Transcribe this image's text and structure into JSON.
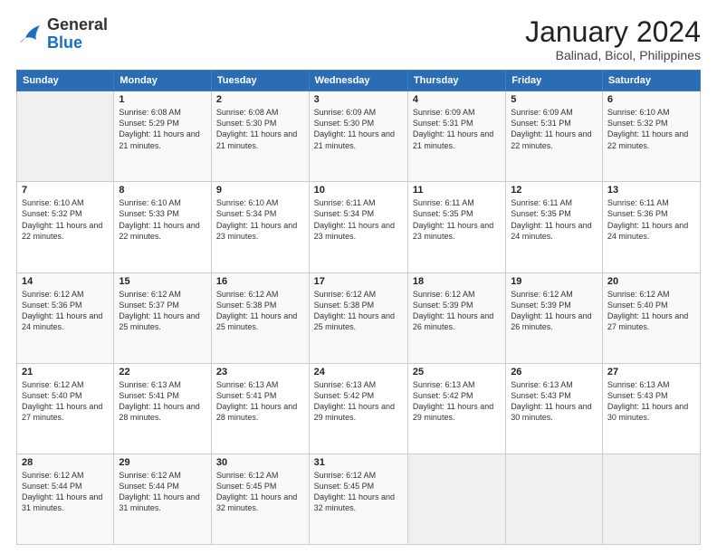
{
  "header": {
    "logo": {
      "general": "General",
      "blue": "Blue"
    },
    "title": "January 2024",
    "subtitle": "Balinad, Bicol, Philippines"
  },
  "days_header": [
    "Sunday",
    "Monday",
    "Tuesday",
    "Wednesday",
    "Thursday",
    "Friday",
    "Saturday"
  ],
  "weeks": [
    [
      {
        "day": "",
        "sunrise": "",
        "sunset": "",
        "daylight": ""
      },
      {
        "day": "1",
        "sunrise": "Sunrise: 6:08 AM",
        "sunset": "Sunset: 5:29 PM",
        "daylight": "Daylight: 11 hours and 21 minutes."
      },
      {
        "day": "2",
        "sunrise": "Sunrise: 6:08 AM",
        "sunset": "Sunset: 5:30 PM",
        "daylight": "Daylight: 11 hours and 21 minutes."
      },
      {
        "day": "3",
        "sunrise": "Sunrise: 6:09 AM",
        "sunset": "Sunset: 5:30 PM",
        "daylight": "Daylight: 11 hours and 21 minutes."
      },
      {
        "day": "4",
        "sunrise": "Sunrise: 6:09 AM",
        "sunset": "Sunset: 5:31 PM",
        "daylight": "Daylight: 11 hours and 21 minutes."
      },
      {
        "day": "5",
        "sunrise": "Sunrise: 6:09 AM",
        "sunset": "Sunset: 5:31 PM",
        "daylight": "Daylight: 11 hours and 22 minutes."
      },
      {
        "day": "6",
        "sunrise": "Sunrise: 6:10 AM",
        "sunset": "Sunset: 5:32 PM",
        "daylight": "Daylight: 11 hours and 22 minutes."
      }
    ],
    [
      {
        "day": "7",
        "sunrise": "Sunrise: 6:10 AM",
        "sunset": "Sunset: 5:32 PM",
        "daylight": "Daylight: 11 hours and 22 minutes."
      },
      {
        "day": "8",
        "sunrise": "Sunrise: 6:10 AM",
        "sunset": "Sunset: 5:33 PM",
        "daylight": "Daylight: 11 hours and 22 minutes."
      },
      {
        "day": "9",
        "sunrise": "Sunrise: 6:10 AM",
        "sunset": "Sunset: 5:34 PM",
        "daylight": "Daylight: 11 hours and 23 minutes."
      },
      {
        "day": "10",
        "sunrise": "Sunrise: 6:11 AM",
        "sunset": "Sunset: 5:34 PM",
        "daylight": "Daylight: 11 hours and 23 minutes."
      },
      {
        "day": "11",
        "sunrise": "Sunrise: 6:11 AM",
        "sunset": "Sunset: 5:35 PM",
        "daylight": "Daylight: 11 hours and 23 minutes."
      },
      {
        "day": "12",
        "sunrise": "Sunrise: 6:11 AM",
        "sunset": "Sunset: 5:35 PM",
        "daylight": "Daylight: 11 hours and 24 minutes."
      },
      {
        "day": "13",
        "sunrise": "Sunrise: 6:11 AM",
        "sunset": "Sunset: 5:36 PM",
        "daylight": "Daylight: 11 hours and 24 minutes."
      }
    ],
    [
      {
        "day": "14",
        "sunrise": "Sunrise: 6:12 AM",
        "sunset": "Sunset: 5:36 PM",
        "daylight": "Daylight: 11 hours and 24 minutes."
      },
      {
        "day": "15",
        "sunrise": "Sunrise: 6:12 AM",
        "sunset": "Sunset: 5:37 PM",
        "daylight": "Daylight: 11 hours and 25 minutes."
      },
      {
        "day": "16",
        "sunrise": "Sunrise: 6:12 AM",
        "sunset": "Sunset: 5:38 PM",
        "daylight": "Daylight: 11 hours and 25 minutes."
      },
      {
        "day": "17",
        "sunrise": "Sunrise: 6:12 AM",
        "sunset": "Sunset: 5:38 PM",
        "daylight": "Daylight: 11 hours and 25 minutes."
      },
      {
        "day": "18",
        "sunrise": "Sunrise: 6:12 AM",
        "sunset": "Sunset: 5:39 PM",
        "daylight": "Daylight: 11 hours and 26 minutes."
      },
      {
        "day": "19",
        "sunrise": "Sunrise: 6:12 AM",
        "sunset": "Sunset: 5:39 PM",
        "daylight": "Daylight: 11 hours and 26 minutes."
      },
      {
        "day": "20",
        "sunrise": "Sunrise: 6:12 AM",
        "sunset": "Sunset: 5:40 PM",
        "daylight": "Daylight: 11 hours and 27 minutes."
      }
    ],
    [
      {
        "day": "21",
        "sunrise": "Sunrise: 6:12 AM",
        "sunset": "Sunset: 5:40 PM",
        "daylight": "Daylight: 11 hours and 27 minutes."
      },
      {
        "day": "22",
        "sunrise": "Sunrise: 6:13 AM",
        "sunset": "Sunset: 5:41 PM",
        "daylight": "Daylight: 11 hours and 28 minutes."
      },
      {
        "day": "23",
        "sunrise": "Sunrise: 6:13 AM",
        "sunset": "Sunset: 5:41 PM",
        "daylight": "Daylight: 11 hours and 28 minutes."
      },
      {
        "day": "24",
        "sunrise": "Sunrise: 6:13 AM",
        "sunset": "Sunset: 5:42 PM",
        "daylight": "Daylight: 11 hours and 29 minutes."
      },
      {
        "day": "25",
        "sunrise": "Sunrise: 6:13 AM",
        "sunset": "Sunset: 5:42 PM",
        "daylight": "Daylight: 11 hours and 29 minutes."
      },
      {
        "day": "26",
        "sunrise": "Sunrise: 6:13 AM",
        "sunset": "Sunset: 5:43 PM",
        "daylight": "Daylight: 11 hours and 30 minutes."
      },
      {
        "day": "27",
        "sunrise": "Sunrise: 6:13 AM",
        "sunset": "Sunset: 5:43 PM",
        "daylight": "Daylight: 11 hours and 30 minutes."
      }
    ],
    [
      {
        "day": "28",
        "sunrise": "Sunrise: 6:12 AM",
        "sunset": "Sunset: 5:44 PM",
        "daylight": "Daylight: 11 hours and 31 minutes."
      },
      {
        "day": "29",
        "sunrise": "Sunrise: 6:12 AM",
        "sunset": "Sunset: 5:44 PM",
        "daylight": "Daylight: 11 hours and 31 minutes."
      },
      {
        "day": "30",
        "sunrise": "Sunrise: 6:12 AM",
        "sunset": "Sunset: 5:45 PM",
        "daylight": "Daylight: 11 hours and 32 minutes."
      },
      {
        "day": "31",
        "sunrise": "Sunrise: 6:12 AM",
        "sunset": "Sunset: 5:45 PM",
        "daylight": "Daylight: 11 hours and 32 minutes."
      },
      {
        "day": "",
        "sunrise": "",
        "sunset": "",
        "daylight": ""
      },
      {
        "day": "",
        "sunrise": "",
        "sunset": "",
        "daylight": ""
      },
      {
        "day": "",
        "sunrise": "",
        "sunset": "",
        "daylight": ""
      }
    ]
  ]
}
